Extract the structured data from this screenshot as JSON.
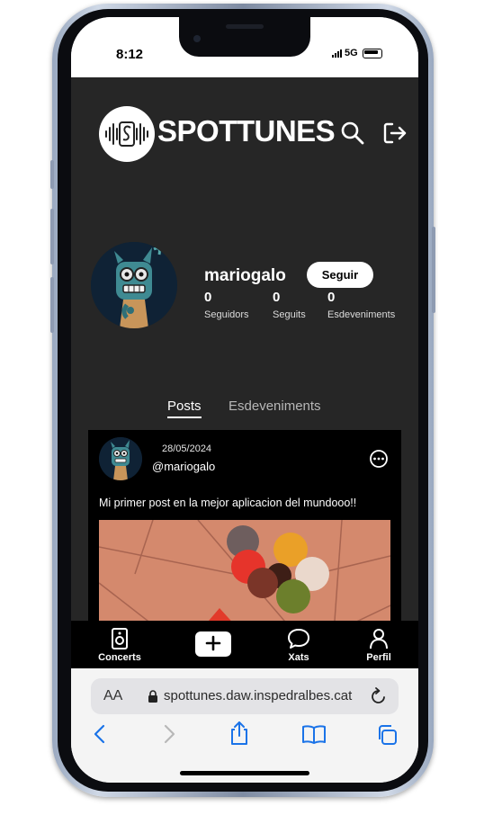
{
  "status_bar": {
    "time": "8:12",
    "network": "5G"
  },
  "app": {
    "brand": "SPOTTUNES",
    "profile": {
      "username": "mariogalo",
      "follow_label": "Seguir",
      "stats": [
        {
          "value": "0",
          "label": "Seguidors"
        },
        {
          "value": "0",
          "label": "Seguits"
        },
        {
          "value": "0",
          "label": "Esdeveniments"
        }
      ]
    },
    "tabs": {
      "posts": "Posts",
      "events": "Esdeveniments"
    },
    "post": {
      "date": "28/05/2024",
      "user": "@mariogalo",
      "text": "Mi primer post en la mejor aplicacion del mundooo!!"
    },
    "bottom_nav": {
      "concerts": "Concerts",
      "chats": "Xats",
      "profile": "Perfil"
    }
  },
  "browser": {
    "aa_label": "AA",
    "url": "spottunes.daw.inspedralbes.cat"
  },
  "colors": {
    "app_bg": "#262626",
    "post_bg": "#000000",
    "image_bg": "#d4896d",
    "browser_blue": "#1a73e8"
  }
}
